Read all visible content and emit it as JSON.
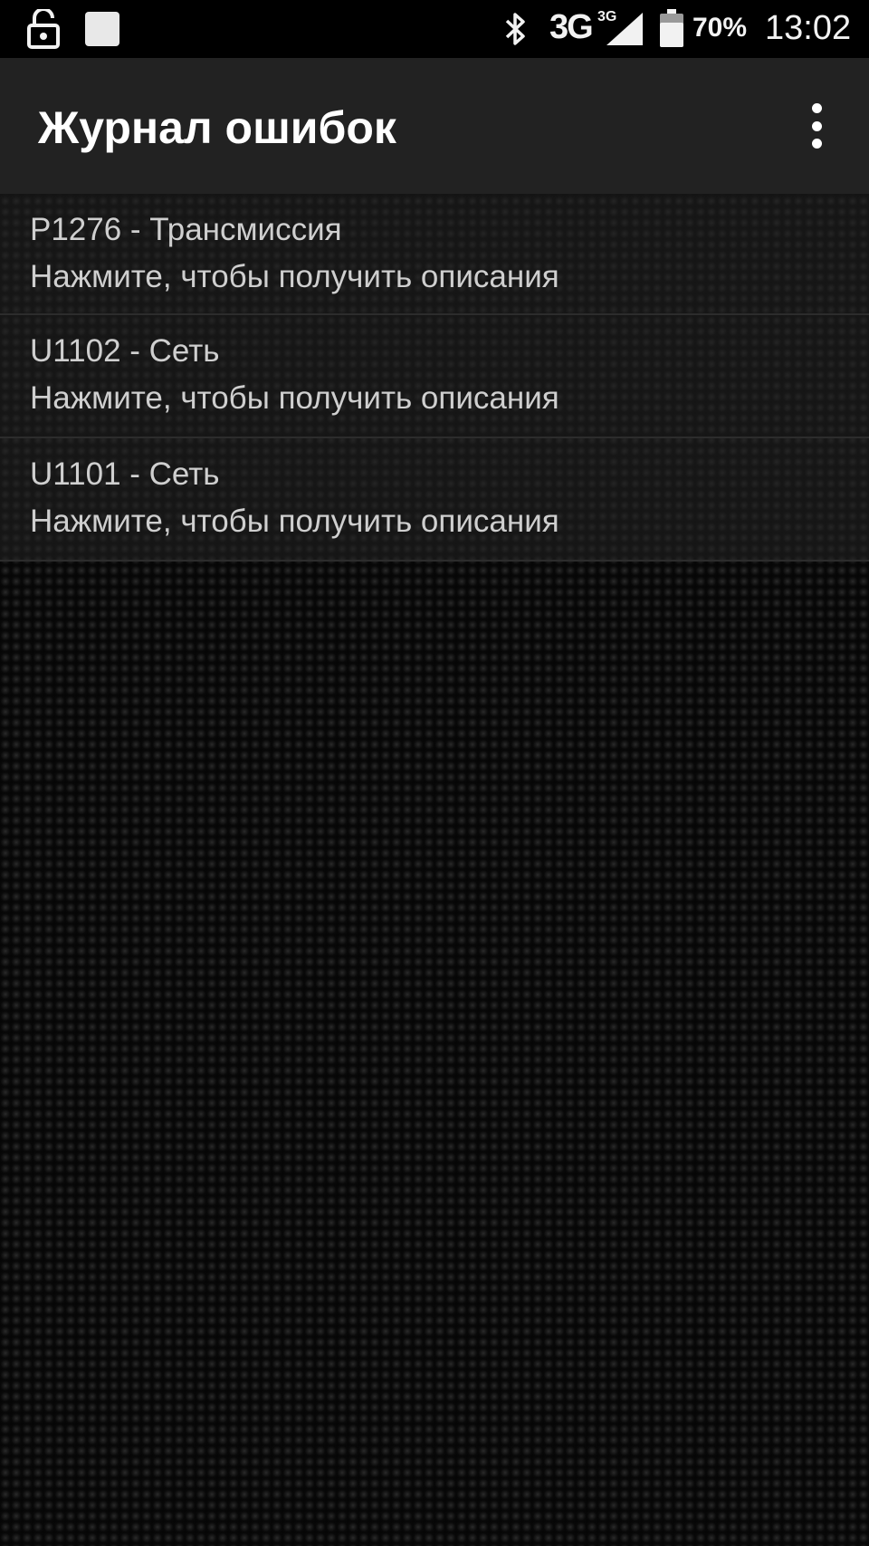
{
  "status_bar": {
    "icons": {
      "lock": "lock-open-icon",
      "notification": "square-notification-icon",
      "bluetooth": "bluetooth-icon",
      "signal": "signal-icon",
      "battery": "battery-icon"
    },
    "network_type": "3G",
    "network_type_small": "3G",
    "battery_percent": "70%",
    "time": "13:02"
  },
  "toolbar": {
    "title": "Журнал ошибок",
    "overflow_icon": "more-vert-icon"
  },
  "errors": [
    {
      "code": "P1276 - Трансмиссия",
      "hint": "Нажмите, чтобы получить описания"
    },
    {
      "code": "U1102 - Сеть",
      "hint": "Нажмите, чтобы получить описания"
    },
    {
      "code": "U1101 - Сеть",
      "hint": "Нажмите, чтобы получить описания"
    }
  ],
  "colors": {
    "status_bar_bg": "#000000",
    "toolbar_bg": "#222222",
    "list_text": "#cfcfcf",
    "title_text": "#ffffff"
  }
}
